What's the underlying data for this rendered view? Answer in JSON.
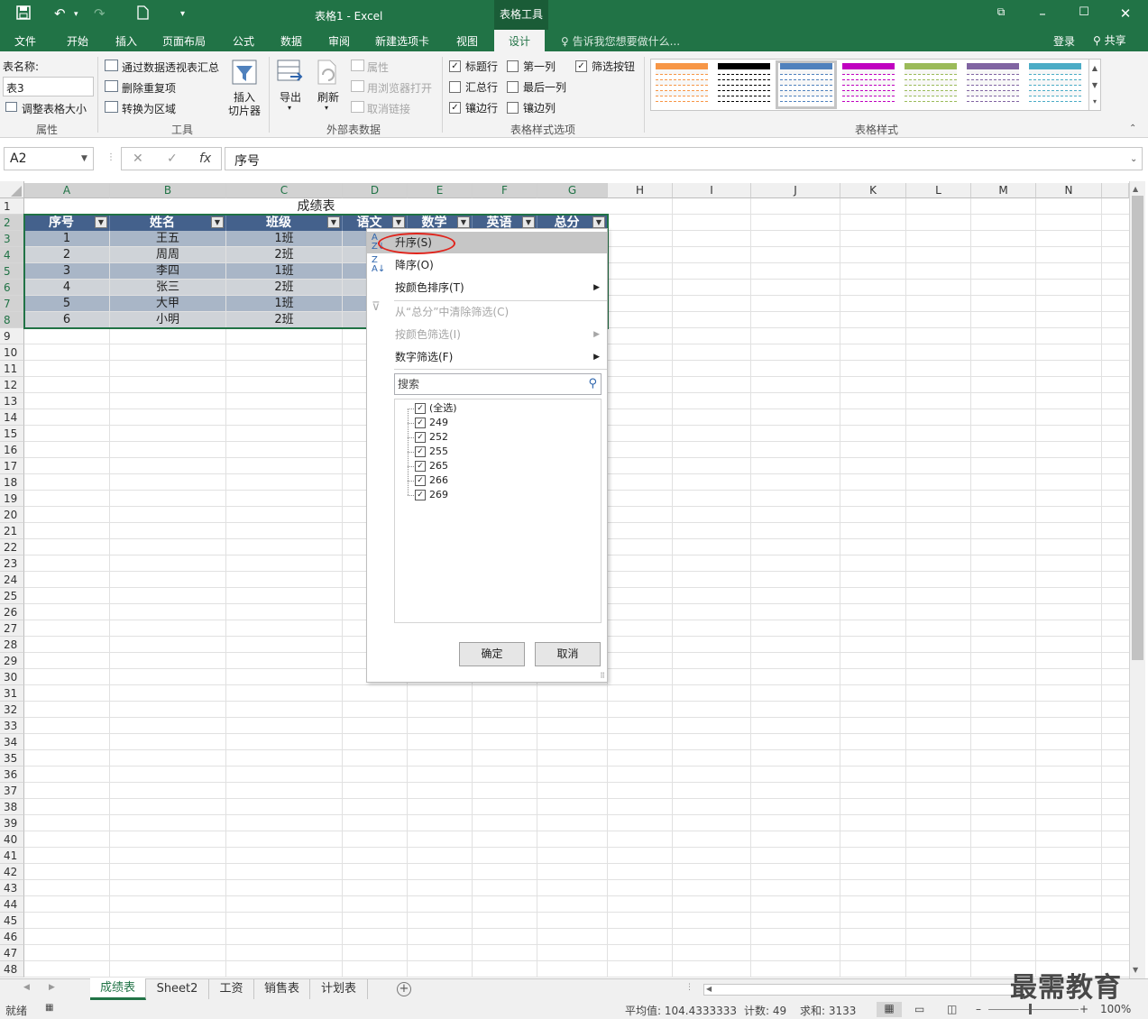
{
  "titlebar": {
    "title": "表格1 - Excel",
    "context_tab": "表格工具",
    "save_icon": "save-icon",
    "undo_icon": "undo-icon",
    "redo_icon": "redo-icon",
    "new_icon": "new-file-icon"
  },
  "ribbon_tabs": [
    {
      "label": "文件"
    },
    {
      "label": "开始"
    },
    {
      "label": "插入"
    },
    {
      "label": "页面布局"
    },
    {
      "label": "公式"
    },
    {
      "label": "数据"
    },
    {
      "label": "审阅"
    },
    {
      "label": "新建选项卡"
    },
    {
      "label": "视图"
    },
    {
      "label": "设计"
    }
  ],
  "tell_me": "告诉我您想要做什么...",
  "login": "登录",
  "share": "共享",
  "ribbon": {
    "properties": {
      "name_label": "表名称:",
      "name_value": "表3",
      "resize": "调整表格大小",
      "group": "属性"
    },
    "tools": {
      "pivot": "通过数据透视表汇总",
      "remove_dup": "删除重复项",
      "convert": "转换为区域",
      "slicer_line1": "插入",
      "slicer_line2": "切片器",
      "group": "工具"
    },
    "external": {
      "export": "导出",
      "refresh": "刷新",
      "properties": "属性",
      "open_browser": "用浏览器打开",
      "unlink": "取消链接",
      "group": "外部表数据"
    },
    "style_options": {
      "header_row": "标题行",
      "first_col": "第一列",
      "filter_btn": "筛选按钮",
      "total_row": "汇总行",
      "last_col": "最后一列",
      "banded_rows": "镶边行",
      "banded_cols": "镶边列",
      "group": "表格样式选项"
    },
    "styles_group": "表格样式",
    "style_colors": [
      "#f79646",
      "#000000",
      "#4f81bd",
      "#c000c0",
      "#9bbb59",
      "#8064a2",
      "#4bacc6"
    ]
  },
  "formula_bar": {
    "name_box": "A2",
    "cancel": "✕",
    "enter": "✓",
    "fx": "fx",
    "formula": "序号"
  },
  "columns": [
    "A",
    "B",
    "C",
    "D",
    "E",
    "F",
    "G",
    "H",
    "I",
    "J",
    "K",
    "L",
    "M",
    "N"
  ],
  "table": {
    "title": "成绩表",
    "headers": [
      "序号",
      "姓名",
      "班级",
      "语文",
      "数学",
      "英语",
      "总分"
    ],
    "rows": [
      [
        "1",
        "王五",
        "1班"
      ],
      [
        "2",
        "周周",
        "2班"
      ],
      [
        "3",
        "李四",
        "1班"
      ],
      [
        "4",
        "张三",
        "2班"
      ],
      [
        "5",
        "大甲",
        "1班"
      ],
      [
        "6",
        "小明",
        "2班"
      ]
    ]
  },
  "dropdown": {
    "sort_asc": "升序(S)",
    "sort_desc": "降序(O)",
    "sort_color": "按颜色排序(T)",
    "clear_filter": "从“总分”中清除筛选(C)",
    "filter_color": "按颜色筛选(I)",
    "number_filter": "数字筛选(F)",
    "search_placeholder": "搜索",
    "list": [
      "(全选)",
      "249",
      "252",
      "255",
      "265",
      "266",
      "269"
    ],
    "ok": "确定",
    "cancel": "取消"
  },
  "sheets": [
    {
      "label": "成绩表",
      "active": true
    },
    {
      "label": "Sheet2"
    },
    {
      "label": "工资"
    },
    {
      "label": "销售表"
    },
    {
      "label": "计划表"
    }
  ],
  "status": {
    "ready": "就绪",
    "average": "平均值: 104.4333333",
    "count": "计数: 49",
    "sum": "求和: 3133",
    "zoom": "100%"
  },
  "watermark": "最需教育"
}
